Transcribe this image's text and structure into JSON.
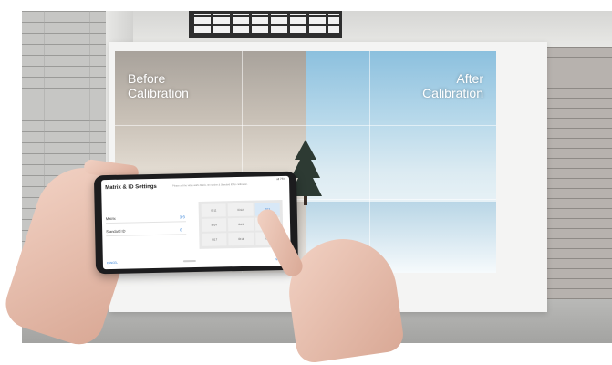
{
  "display": {
    "before_label": "Before\nCalibration",
    "after_label": "After\nCalibration"
  },
  "phone_app": {
    "title": "Matrix & ID Settings",
    "note": "Please set the video wall's Matrix, ID number & Standard ID for calibration.",
    "status": "all 75%",
    "rows": [
      {
        "label": "Matrix",
        "value": "3*3"
      },
      {
        "label": "Standard ID",
        "value": "0"
      }
    ],
    "grid_cells": [
      "ID11",
      "ID12",
      "ID13",
      "ID14",
      "ID15",
      "ID16",
      "ID17",
      "ID18",
      "ID19"
    ],
    "selected_cell": 2,
    "left_button": "CANCEL",
    "right_button": "NEXT"
  },
  "colors": {
    "accent": "#2a7bd6"
  }
}
